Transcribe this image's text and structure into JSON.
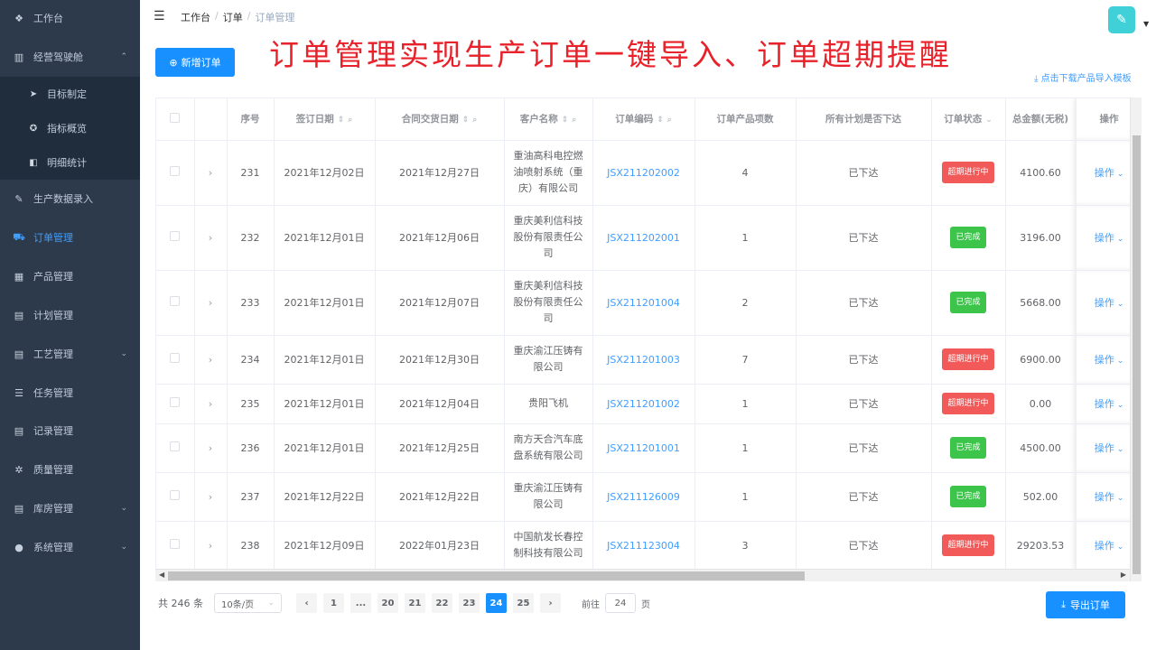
{
  "sidebar": {
    "items": [
      {
        "label": "工作台",
        "icon": "dashboard-icon",
        "glyph": "❖"
      },
      {
        "label": "经营驾驶舱",
        "icon": "bar-chart-icon",
        "glyph": "▥",
        "expandable": true
      },
      {
        "label": "生产数据录入",
        "icon": "edit-icon",
        "glyph": "✎"
      },
      {
        "label": "订单管理",
        "icon": "cart-icon",
        "glyph": "⛟",
        "active": true
      },
      {
        "label": "产品管理",
        "icon": "grid-icon",
        "glyph": "▦"
      },
      {
        "label": "计划管理",
        "icon": "calendar-icon",
        "glyph": "▤"
      },
      {
        "label": "工艺管理",
        "icon": "document-icon",
        "glyph": "▤",
        "expandable": true
      },
      {
        "label": "任务管理",
        "icon": "list-icon",
        "glyph": "☰"
      },
      {
        "label": "记录管理",
        "icon": "record-icon",
        "glyph": "▤"
      },
      {
        "label": "质量管理",
        "icon": "quality-icon",
        "glyph": "✲"
      },
      {
        "label": "库房管理",
        "icon": "warehouse-icon",
        "glyph": "▤",
        "expandable": true
      },
      {
        "label": "系统管理",
        "icon": "user-icon",
        "glyph": "●",
        "expandable": true
      }
    ],
    "sub_items": [
      {
        "label": "目标制定",
        "icon": "send-icon",
        "glyph": "➤"
      },
      {
        "label": "指标概览",
        "icon": "target-icon",
        "glyph": "✪"
      },
      {
        "label": "明细统计",
        "icon": "detail-icon",
        "glyph": "◧"
      }
    ]
  },
  "header": {
    "breadcrumb": [
      "工作台",
      "订单",
      "订单管理"
    ],
    "separator": "/"
  },
  "headline": "订单管理实现生产订单一键导入、订单超期提醒",
  "toolbar": {
    "add_label": "新增订单",
    "download_label": "点击下载产品导入模板",
    "export_label": "导出订单"
  },
  "table": {
    "columns": [
      "序号",
      "签订日期",
      "合同交货日期",
      "客户名称",
      "订单编码",
      "订单产品项数",
      "所有计划是否下达",
      "订单状态",
      "总金额(无税)",
      "操作"
    ],
    "rows": [
      {
        "no": "231",
        "sign": "2021年12月02日",
        "delivery": "2021年12月27日",
        "customer": "重油高科电控燃油喷射系统（重庆）有限公司",
        "code": "JSX211202002",
        "items": "4",
        "issued": "已下达",
        "status": "超期进行中",
        "status_color": "red",
        "amount": "4100.60",
        "op": "操作"
      },
      {
        "no": "232",
        "sign": "2021年12月01日",
        "delivery": "2021年12月06日",
        "customer": "重庆美利信科技股份有限责任公司",
        "code": "JSX211202001",
        "items": "1",
        "issued": "已下达",
        "status": "已完成",
        "status_color": "green",
        "amount": "3196.00",
        "op": "操作"
      },
      {
        "no": "233",
        "sign": "2021年12月01日",
        "delivery": "2021年12月07日",
        "customer": "重庆美利信科技股份有限责任公司",
        "code": "JSX211201004",
        "items": "2",
        "issued": "已下达",
        "status": "已完成",
        "status_color": "green",
        "amount": "5668.00",
        "op": "操作"
      },
      {
        "no": "234",
        "sign": "2021年12月01日",
        "delivery": "2021年12月30日",
        "customer": "重庆渝江压铸有限公司",
        "code": "JSX211201003",
        "items": "7",
        "issued": "已下达",
        "status": "超期进行中",
        "status_color": "red",
        "amount": "6900.00",
        "op": "操作"
      },
      {
        "no": "235",
        "sign": "2021年12月01日",
        "delivery": "2021年12月04日",
        "customer": "贵阳飞机",
        "code": "JSX211201002",
        "items": "1",
        "issued": "已下达",
        "status": "超期进行中",
        "status_color": "red",
        "amount": "0.00",
        "op": "操作"
      },
      {
        "no": "236",
        "sign": "2021年12月01日",
        "delivery": "2021年12月25日",
        "customer": "南方天合汽车底盘系统有限公司",
        "code": "JSX211201001",
        "items": "1",
        "issued": "已下达",
        "status": "已完成",
        "status_color": "green",
        "amount": "4500.00",
        "op": "操作"
      },
      {
        "no": "237",
        "sign": "2021年12月22日",
        "delivery": "2021年12月22日",
        "customer": "重庆渝江压铸有限公司",
        "code": "JSX211126009",
        "items": "1",
        "issued": "已下达",
        "status": "已完成",
        "status_color": "green",
        "amount": "502.00",
        "op": "操作"
      },
      {
        "no": "238",
        "sign": "2021年12月09日",
        "delivery": "2022年01月23日",
        "customer": "中国航发长春控制科技有限公司",
        "code": "JSX211123004",
        "items": "3",
        "issued": "已下达",
        "status": "超期进行中",
        "status_color": "red",
        "amount": "29203.53",
        "op": "操作"
      }
    ]
  },
  "pagination": {
    "total": "共 246 条",
    "page_size": "10条/页",
    "pages": [
      "1",
      "...",
      "20",
      "21",
      "22",
      "23",
      "24",
      "25"
    ],
    "current": "24",
    "goto_label": "前往",
    "goto_value": "24",
    "goto_suffix": "页"
  },
  "colors": {
    "sidebar_bg": "#2d3a4b",
    "accent": "#1890ff",
    "danger": "#f25a5a",
    "success": "#3dc54b",
    "headline": "#e8222a"
  }
}
